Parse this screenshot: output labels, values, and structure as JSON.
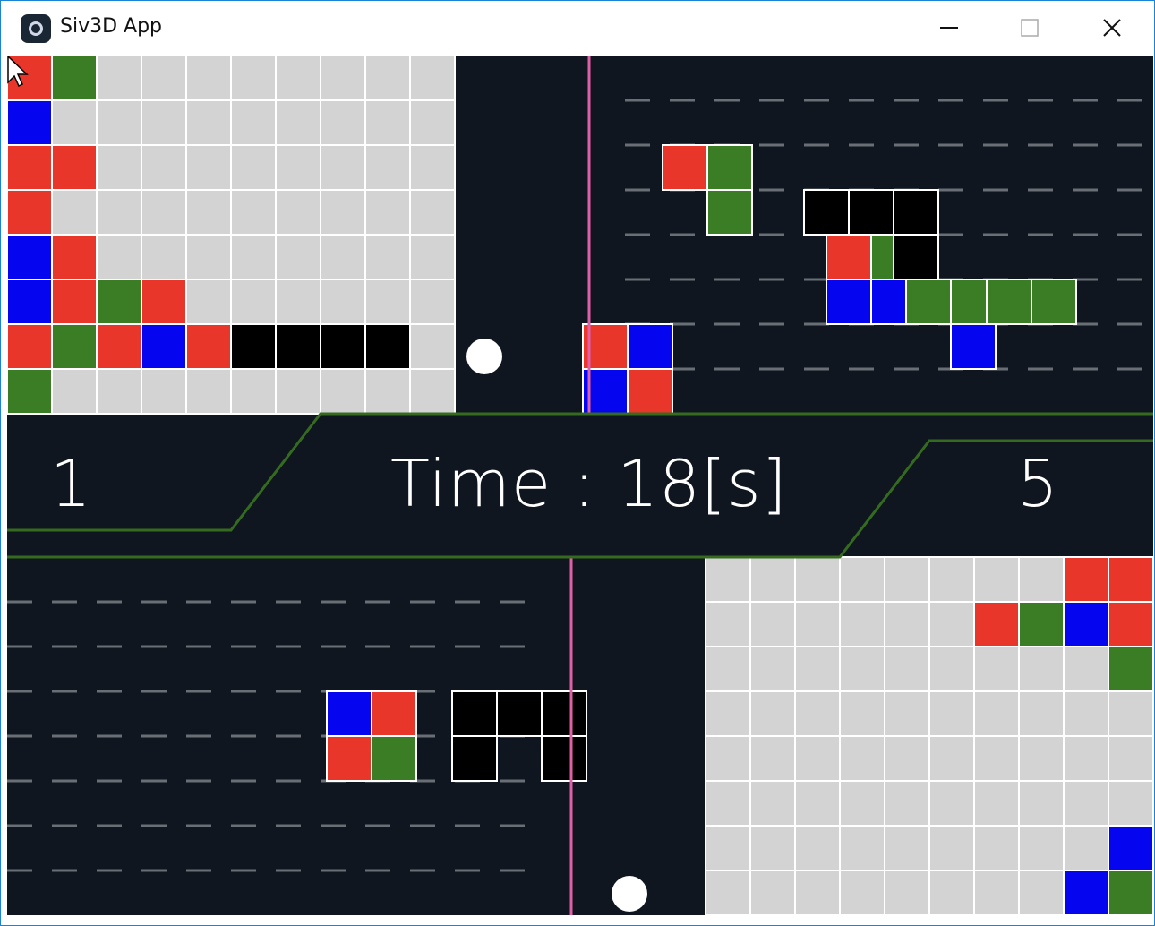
{
  "window": {
    "title": "Siv3D App",
    "controls": {
      "minimize": "—",
      "maximize": "☐",
      "close": "✕"
    },
    "icon": "siv3d-app-icon"
  },
  "hud": {
    "left_score": "1",
    "time_label": "Time : 18[s]",
    "right_score": "5"
  },
  "colors": {
    "background": "#0f1620",
    "empty_cell": "#d3d3d3",
    "red": "#e8362a",
    "green": "#3a7d25",
    "blue": "#0505f0",
    "black": "#000000",
    "cell_border": "#ffffff",
    "lane_line": "#6a6f75",
    "divider_line": "#e060a8",
    "hud_outline": "#356b1f",
    "ball": "#ffffff"
  },
  "board_top_left": {
    "rows": [
      [
        "R",
        "G",
        "E",
        "E",
        "E",
        "E",
        "E",
        "E",
        "E",
        "E"
      ],
      [
        "B",
        "E",
        "E",
        "E",
        "E",
        "E",
        "E",
        "E",
        "E",
        "E"
      ],
      [
        "R",
        "R",
        "E",
        "E",
        "E",
        "E",
        "E",
        "E",
        "E",
        "E"
      ],
      [
        "R",
        "E",
        "E",
        "E",
        "E",
        "E",
        "E",
        "E",
        "E",
        "E"
      ],
      [
        "B",
        "R",
        "E",
        "E",
        "E",
        "E",
        "E",
        "E",
        "E",
        "E"
      ],
      [
        "B",
        "R",
        "G",
        "R",
        "E",
        "E",
        "E",
        "E",
        "E",
        "E"
      ],
      [
        "R",
        "G",
        "R",
        "B",
        "R",
        "K",
        "K",
        "K",
        "K",
        "E"
      ],
      [
        "G",
        "E",
        "E",
        "E",
        "E",
        "E",
        "E",
        "E",
        "E",
        "E"
      ]
    ]
  },
  "board_bottom_right": {
    "rows": [
      [
        "E",
        "E",
        "E",
        "E",
        "E",
        "E",
        "E",
        "E",
        "R",
        "R"
      ],
      [
        "E",
        "E",
        "E",
        "E",
        "E",
        "E",
        "R",
        "G",
        "B",
        "R"
      ],
      [
        "E",
        "E",
        "E",
        "E",
        "E",
        "E",
        "E",
        "E",
        "E",
        "G"
      ],
      [
        "E",
        "E",
        "E",
        "E",
        "E",
        "E",
        "E",
        "E",
        "E",
        "E"
      ],
      [
        "E",
        "E",
        "E",
        "E",
        "E",
        "E",
        "E",
        "E",
        "E",
        "E"
      ],
      [
        "E",
        "E",
        "E",
        "E",
        "E",
        "E",
        "E",
        "E",
        "E",
        "E"
      ],
      [
        "E",
        "E",
        "E",
        "E",
        "E",
        "E",
        "E",
        "E",
        "E",
        "B"
      ],
      [
        "E",
        "E",
        "E",
        "E",
        "E",
        "E",
        "E",
        "E",
        "B",
        "G"
      ]
    ]
  },
  "cursor": "mouse-pointer-icon"
}
